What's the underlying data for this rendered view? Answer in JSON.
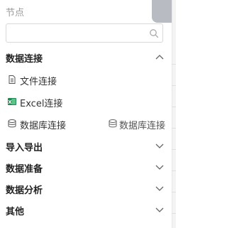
{
  "panel": {
    "title": "节点"
  },
  "search": {
    "value": "",
    "placeholder": ""
  },
  "sections": {
    "data_connect": {
      "label": "数据连接",
      "expanded": true,
      "items": {
        "file": {
          "label": "文件连接",
          "icon": "file-icon"
        },
        "excel": {
          "label": "Excel连接",
          "icon": "excel-icon",
          "icon_color": "#1e8a4f"
        },
        "db": {
          "label": "数据库连接",
          "icon": "database-icon"
        },
        "db2": {
          "label": "数据库连接",
          "icon": "database-icon"
        }
      }
    },
    "import_export": {
      "label": "导入导出",
      "expanded": false
    },
    "data_prep": {
      "label": "数据准备",
      "expanded": false
    },
    "data_analysis": {
      "label": "数据分析",
      "expanded": false
    },
    "other": {
      "label": "其他",
      "expanded": false
    }
  }
}
